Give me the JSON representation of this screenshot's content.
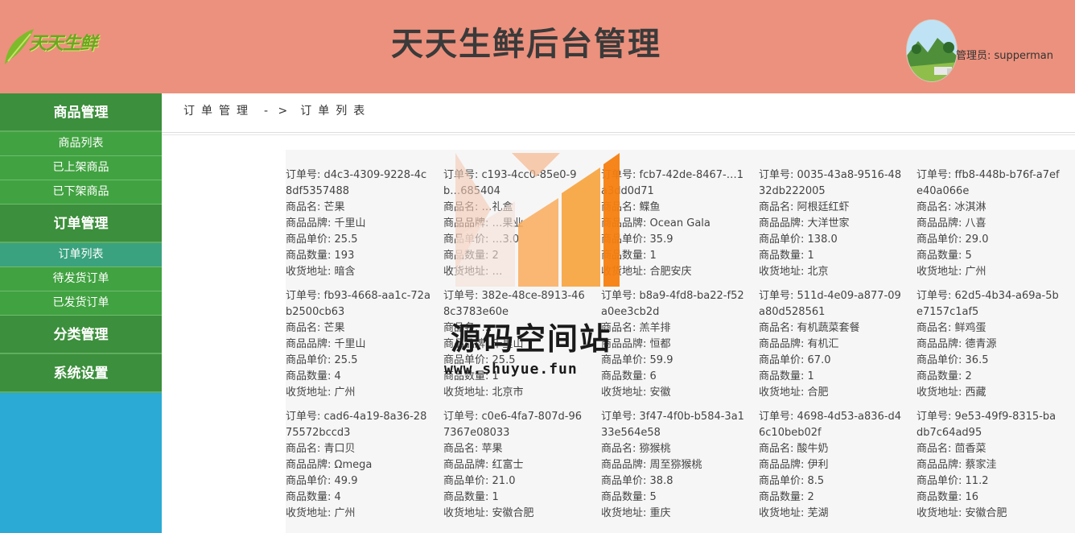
{
  "header": {
    "logo_text": "天天生鲜",
    "title": "天天生鲜后台管理",
    "admin": "管理员: supperman"
  },
  "sidebar": {
    "groups": [
      {
        "label": "商品管理",
        "items": [
          "商品列表",
          "已上架商品",
          "已下架商品"
        ]
      },
      {
        "label": "订单管理",
        "items": [
          "订单列表",
          "待发货订单",
          "已发货订单"
        ]
      },
      {
        "label": "分类管理",
        "items": []
      },
      {
        "label": "系统设置",
        "items": []
      }
    ],
    "active_item": "订单列表"
  },
  "breadcrumb": {
    "parent": "订单管理",
    "sep": "- >",
    "current": "订单列表"
  },
  "labels": {
    "order_no": "订单号:",
    "name": "商品名:",
    "brand": "商品品牌:",
    "price": "商品单价:",
    "qty": "商品数量:",
    "address": "收货地址:"
  },
  "orders": [
    {
      "id": "d4c3-4309-9228-4c8df5357488",
      "name": "芒果",
      "brand": "千里山",
      "price": "25.5",
      "qty": "193",
      "address": "暗含"
    },
    {
      "id": "c193-4cc0-85e0-9b…685404",
      "name": "…礼盒",
      "brand": "…果业",
      "price": "…3.0",
      "qty": "2",
      "address": "…"
    },
    {
      "id": "fcb7-42de-8467-…1a3dd0d71",
      "name": "鲽鱼",
      "brand": "Ocean Gala",
      "price": "35.9",
      "qty": "1",
      "address": "合肥安庆"
    },
    {
      "id": "0035-43a8-9516-4832db222005",
      "name": "阿根廷红虾",
      "brand": "大洋世家",
      "price": "138.0",
      "qty": "1",
      "address": "北京"
    },
    {
      "id": "ffb8-448b-b76f-a7efe40a066e",
      "name": "冰淇淋",
      "brand": "八喜",
      "price": "29.0",
      "qty": "5",
      "address": "广州"
    },
    {
      "id": "fb93-4668-aa1c-72ab2500cb63",
      "name": "芒果",
      "brand": "千里山",
      "price": "25.5",
      "qty": "4",
      "address": "广州"
    },
    {
      "id": "382e-48ce-8913-468c3783e60e",
      "name": "…",
      "brand": "千里山",
      "price": "25.5",
      "qty": "1",
      "address": "北京市"
    },
    {
      "id": "b8a9-4fd8-ba22-f52a0ee3cb2d",
      "name": "羔羊排",
      "brand": "恒都",
      "price": "59.9",
      "qty": "6",
      "address": "安徽"
    },
    {
      "id": "511d-4e09-a877-09a80d528561",
      "name": "有机蔬菜套餐",
      "brand": "有机汇",
      "price": "67.0",
      "qty": "1",
      "address": "合肥"
    },
    {
      "id": "62d5-4b34-a69a-5be7157c1af5",
      "name": "鲜鸡蛋",
      "brand": "德青源",
      "price": "36.5",
      "qty": "2",
      "address": "西藏"
    },
    {
      "id": "cad6-4a19-8a36-2875572bccd3",
      "name": "青口贝",
      "brand": "Ωmega",
      "price": "49.9",
      "qty": "4",
      "address": "广州"
    },
    {
      "id": "c0e6-4fa7-807d-967367e08033",
      "name": "苹果",
      "brand": "红富士",
      "price": "21.0",
      "qty": "1",
      "address": "安徽合肥"
    },
    {
      "id": "3f47-4f0b-b584-3a133e564e58",
      "name": "猕猴桃",
      "brand": "周至猕猴桃",
      "price": "38.8",
      "qty": "5",
      "address": "重庆"
    },
    {
      "id": "4698-4d53-a836-d46c10beb02f",
      "name": "酸牛奶",
      "brand": "伊利",
      "price": "8.5",
      "qty": "2",
      "address": "芜湖"
    },
    {
      "id": "9e53-49f9-8315-badb7c64ad95",
      "name": "茴香菜",
      "brand": "蔡家洼",
      "price": "11.2",
      "qty": "16",
      "address": "安徽合肥"
    }
  ],
  "watermark": {
    "text": "源码空间站",
    "url": "www.shuyue.fun"
  }
}
